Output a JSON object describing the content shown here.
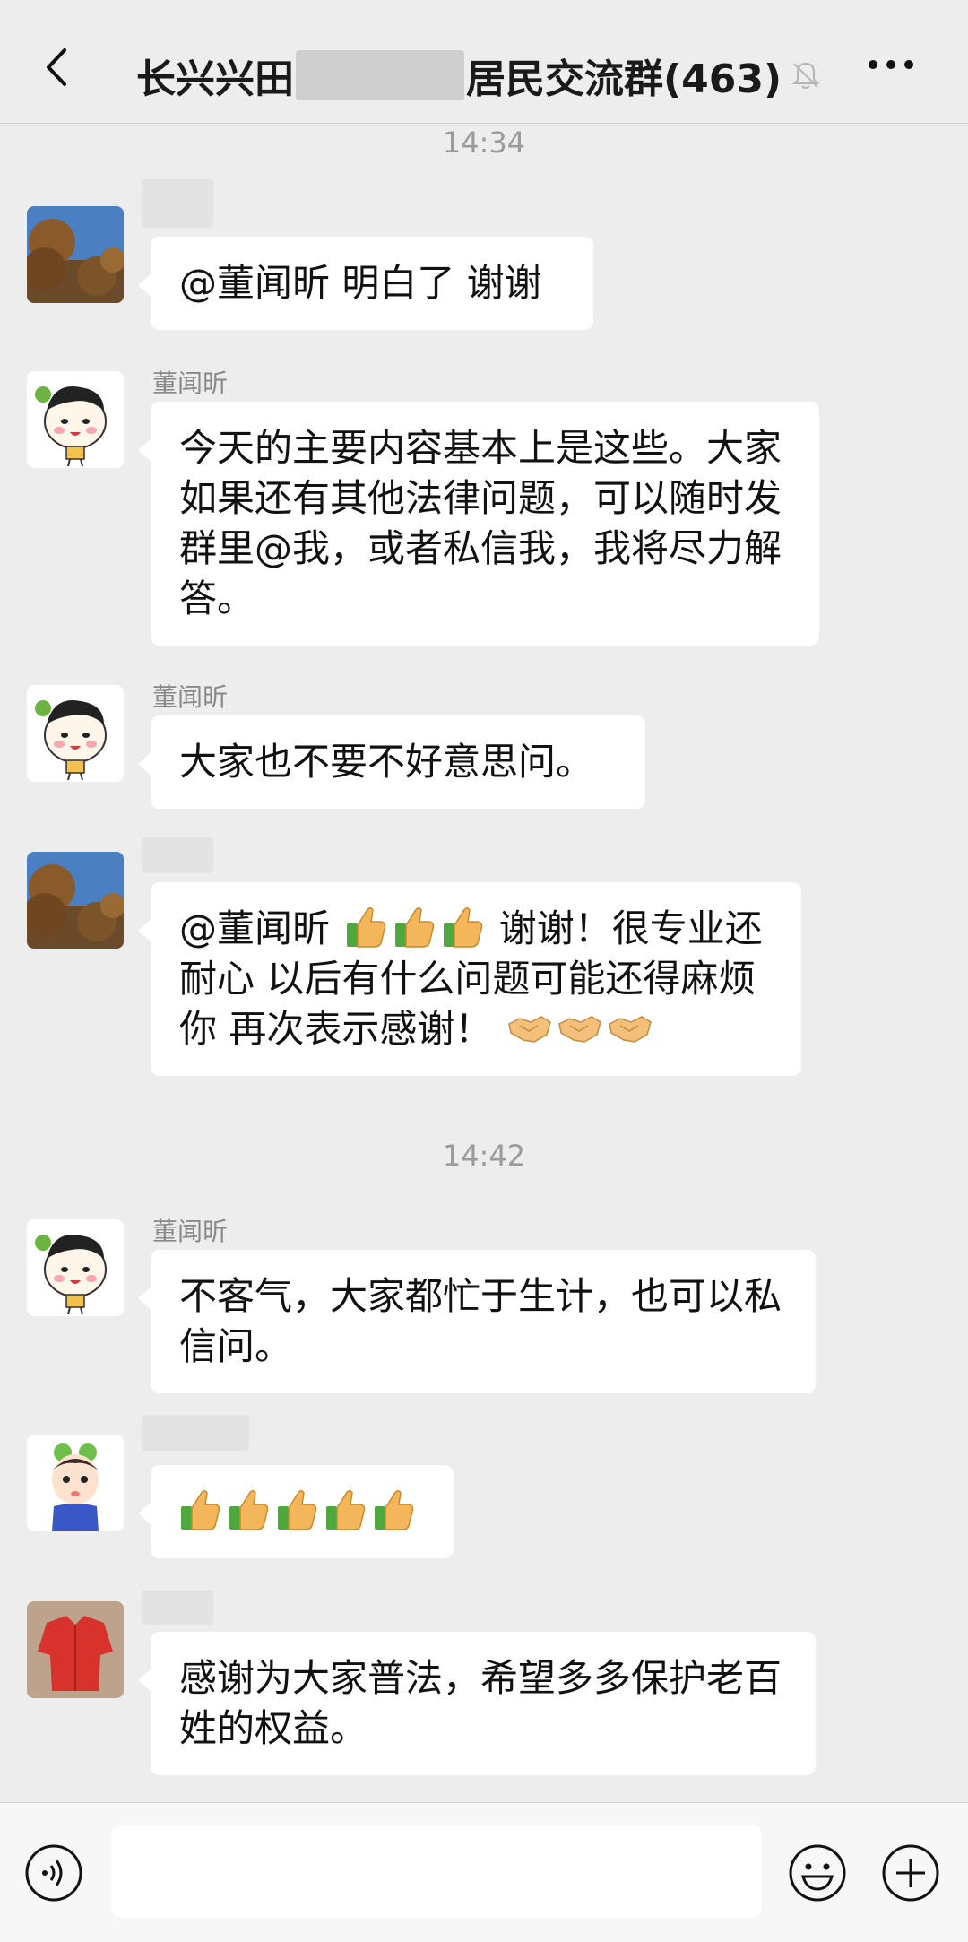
{
  "header": {
    "title_prefix": "长兴兴田",
    "title_suffix": "居民交流群(463)"
  },
  "timestamps": [
    "14:34",
    "14:42"
  ],
  "messages": [
    {
      "sender": "",
      "text": "@董闻昕 明白了 谢谢"
    },
    {
      "sender": "董闻昕",
      "text": "今天的主要内容基本上是这些。大家如果还有其他法律问题，可以随时发群里@我，或者私信我，我将尽力解答。"
    },
    {
      "sender": "董闻昕",
      "text": "大家也不要不好意思问。"
    },
    {
      "sender": "",
      "text_a": "@董闻昕",
      "text_b": "谢谢！很专业还耐心 以后有什么问题可能还得麻烦你 再次表示感谢！"
    },
    {
      "sender": "董闻昕",
      "text": "不客气，大家都忙于生计，也可以私信问。"
    },
    {
      "sender": "",
      "text": "👍👍👍👍👍"
    },
    {
      "sender": "",
      "text": "感谢为大家普法，希望多多保护老百姓的权益。"
    }
  ],
  "icons": {
    "back": "back-icon",
    "mute": "mute-bell-icon",
    "more": "more-icon",
    "voice": "voice-icon",
    "emoji": "emoji-icon",
    "plus": "plus-icon"
  },
  "colors": {
    "background": "#ededed",
    "bubble": "#ffffff",
    "meta_text": "#9b9b9b"
  }
}
